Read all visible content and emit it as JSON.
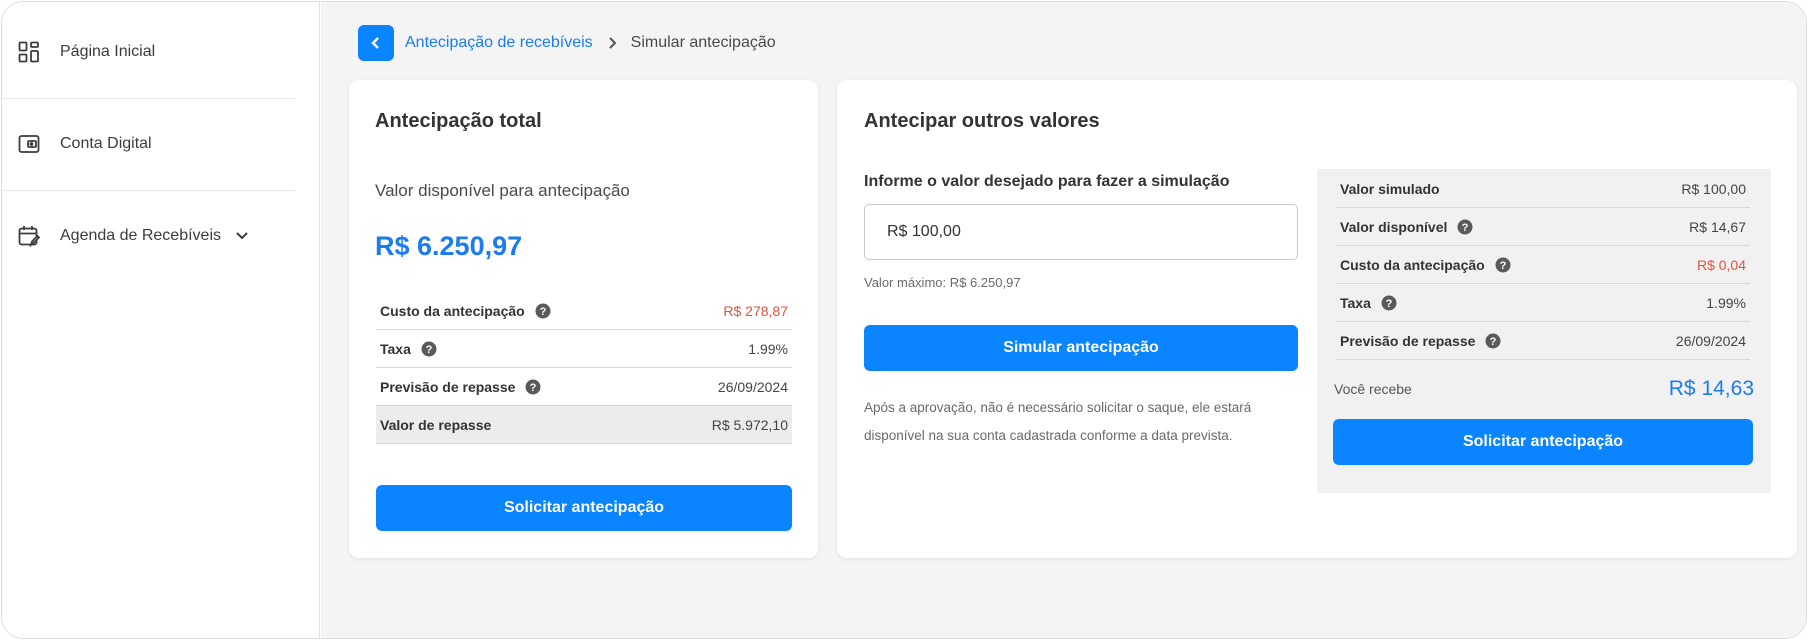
{
  "sidebar": {
    "items": [
      {
        "label": "Página Inicial",
        "icon": "dashboard-icon"
      },
      {
        "label": "Conta Digital",
        "icon": "wallet-icon"
      },
      {
        "label": "Agenda de Recebíveis",
        "icon": "calendar-edit-icon",
        "expandable": true
      }
    ]
  },
  "breadcrumb": {
    "parent": "Antecipação de recebíveis",
    "current": "Simular antecipação"
  },
  "total": {
    "title": "Antecipação total",
    "available_label": "Valor disponível para antecipação",
    "available_value": "R$ 6.250,97",
    "rows": [
      {
        "label": "Custo da antecipação",
        "value": "R$ 278,87",
        "help": true,
        "highlight": "red"
      },
      {
        "label": "Taxa",
        "value": "1.99%",
        "help": true
      },
      {
        "label": "Previsão de repasse",
        "value": "26/09/2024",
        "help": true
      },
      {
        "label": "Valor de repasse",
        "value": "R$ 5.972,10",
        "help": false,
        "shaded": true
      }
    ],
    "button": "Solicitar antecipação"
  },
  "other": {
    "title": "Antecipar outros valores",
    "input_label": "Informe o valor desejado para fazer a simulação",
    "input_value": "R$ 100,00",
    "max_hint": "Valor máximo: R$ 6.250,97",
    "simulate_button": "Simular antecipação",
    "note": "Após a aprovação, não é necessário solicitar o saque, ele estará disponível na sua conta cadastrada conforme a data prevista.",
    "summary": {
      "rows": [
        {
          "label": "Valor simulado",
          "value": "R$ 100,00",
          "help": false
        },
        {
          "label": "Valor disponível",
          "value": "R$ 14,67",
          "help": true
        },
        {
          "label": "Custo da antecipação",
          "value": "R$ 0,04",
          "help": true,
          "highlight": "red"
        },
        {
          "label": "Taxa",
          "value": "1.99%",
          "help": true
        },
        {
          "label": "Previsão de repasse",
          "value": "26/09/2024",
          "help": true
        }
      ],
      "receive_label": "Você recebe",
      "receive_value": "R$ 14,63",
      "button": "Solicitar antecipação"
    }
  },
  "colors": {
    "accent": "#0a84ff",
    "link": "#1a7cf0",
    "negative": "#e5533d"
  }
}
